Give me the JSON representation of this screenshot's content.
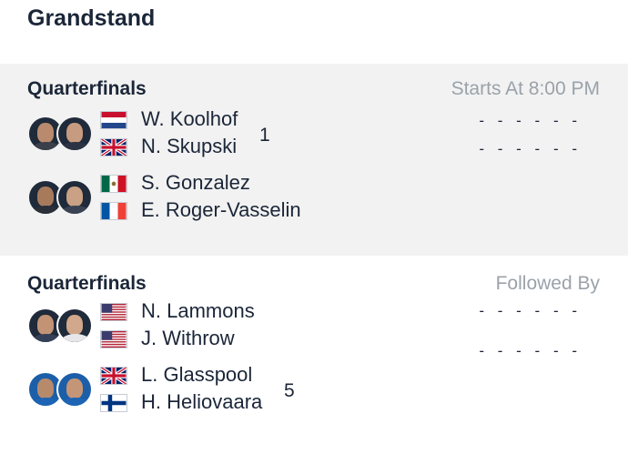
{
  "court": {
    "title": "Grandstand"
  },
  "matches": [
    {
      "round": "Quarterfinals",
      "status": "Starts At 8:00 PM",
      "teams": [
        {
          "seed": "1",
          "score": "- - - - - -",
          "players": [
            {
              "name": "W. Koolhof",
              "flag": "netherlands-flag"
            },
            {
              "name": "N. Skupski",
              "flag": "uk-flag"
            }
          ]
        },
        {
          "seed": "",
          "score": "- - - - - -",
          "players": [
            {
              "name": "S. Gonzalez",
              "flag": "mexico-flag"
            },
            {
              "name": "E. Roger-Vasselin",
              "flag": "france-flag"
            }
          ]
        }
      ]
    },
    {
      "round": "Quarterfinals",
      "status": "Followed By",
      "teams": [
        {
          "seed": "",
          "score": "- - - - - -",
          "players": [
            {
              "name": "N. Lammons",
              "flag": "usa-flag"
            },
            {
              "name": "J. Withrow",
              "flag": "usa-flag"
            }
          ]
        },
        {
          "seed": "5",
          "score": "- - - - - -",
          "players": [
            {
              "name": "L. Glasspool",
              "flag": "uk-flag"
            },
            {
              "name": "H. Heliovaara",
              "flag": "finland-flag"
            }
          ]
        }
      ]
    }
  ],
  "colors": {
    "text": "#1b2638",
    "muted": "#9aa2aa",
    "section_bg": "#f2f2f2"
  }
}
